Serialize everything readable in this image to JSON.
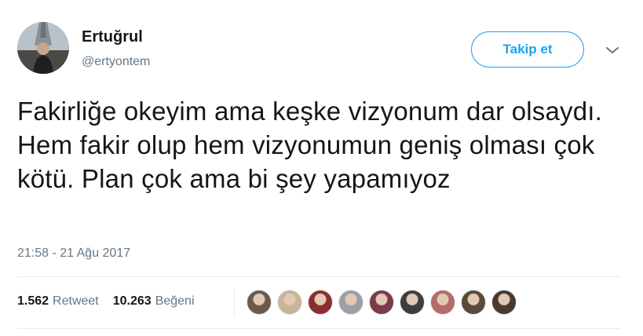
{
  "user": {
    "display_name": "Ertuğrul",
    "handle": "@ertyontem",
    "avatar_icon": "profile-photo-eiffel-tower"
  },
  "follow_button": {
    "label": "Takip et"
  },
  "menu": {
    "icon": "chevron-down-icon"
  },
  "tweet": {
    "text": "Fakirliğe okeyim ama keşke vizyonum dar olsaydı. Hem fakir olup hem vizyonumun geniş olması çok kötü. Plan çok ama bi şey yapamıyoz",
    "timestamp": "21:58 - 21 Ağu 2017"
  },
  "stats": {
    "retweets": {
      "count": "1.562",
      "label": "Retweet"
    },
    "likes": {
      "count": "10.263",
      "label": "Beğeni"
    }
  },
  "liker_avatars": [
    {
      "color": "#6b5a4c"
    },
    {
      "color": "#c9b49a"
    },
    {
      "color": "#8a2f2f"
    },
    {
      "color": "#9aa0a6"
    },
    {
      "color": "#7a3b4a"
    },
    {
      "color": "#3e3e3e"
    },
    {
      "color": "#b46b6b"
    },
    {
      "color": "#5a4a3a"
    },
    {
      "color": "#4a3a2e"
    }
  ],
  "colors": {
    "accent": "#1da1f2",
    "text_primary": "#14171a",
    "text_secondary": "#657786",
    "divider": "#e6ecf0"
  }
}
